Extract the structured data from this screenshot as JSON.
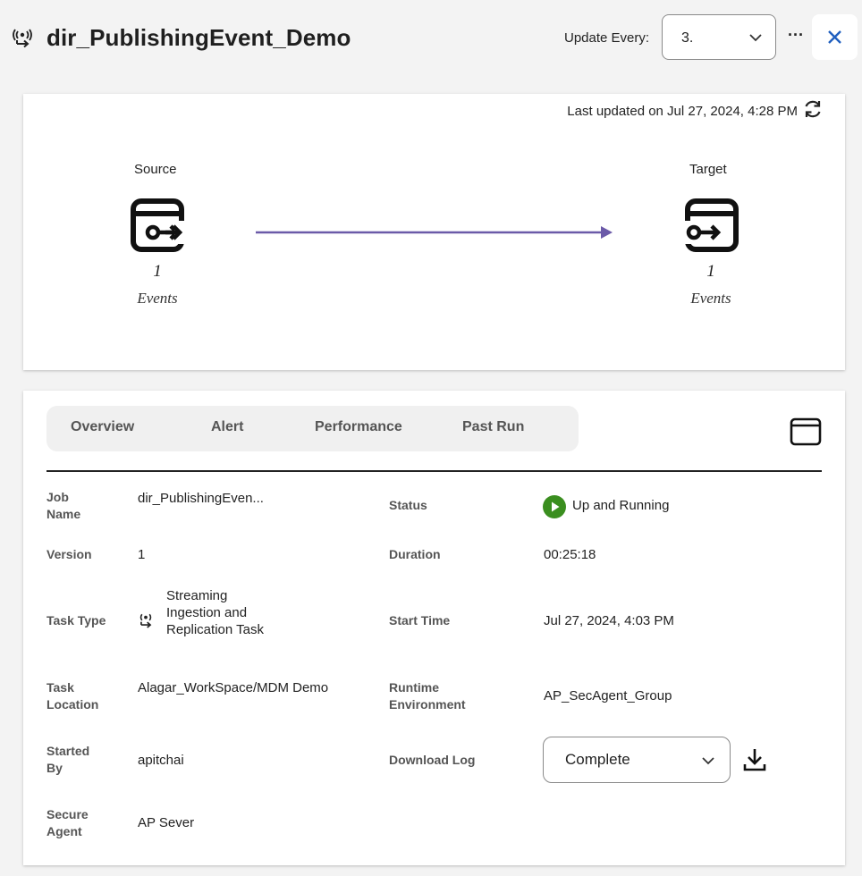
{
  "header": {
    "title": "dir_PublishingEvent_Demo",
    "update_label": "Update Every:",
    "update_value": "3.",
    "more_label": "···"
  },
  "flow": {
    "last_updated": "Last updated on Jul 27, 2024, 4:28 PM",
    "source": {
      "label": "Source",
      "count": "1",
      "unit": "Events"
    },
    "target": {
      "label": "Target",
      "count": "1",
      "unit": "Events"
    },
    "arrow_color": "#6b5aa8"
  },
  "tabs": [
    "Overview",
    "Alert",
    "Performance",
    "Past Run"
  ],
  "details": {
    "job_name": {
      "label": "Job Name",
      "value": "dir_PublishingEven..."
    },
    "version": {
      "label": "Version",
      "value": "1"
    },
    "task_type": {
      "label": "Task Type",
      "value": "Streaming Ingestion and Replication Task"
    },
    "task_location": {
      "label": "Task Location",
      "value": "Alagar_WorkSpace/MDM Demo"
    },
    "started_by": {
      "label": "Started By",
      "value": "apitchai"
    },
    "secure_agent": {
      "label": "Secure Agent",
      "value": "AP Sever"
    },
    "status": {
      "label": "Status",
      "value": "Up and Running",
      "color": "#3a8e1f"
    },
    "duration": {
      "label": "Duration",
      "value": "00:25:18"
    },
    "start_time": {
      "label": "Start Time",
      "value": "Jul 27, 2024, 4:03 PM"
    },
    "runtime_env": {
      "label": "Runtime Environment",
      "value": "AP_SecAgent_Group"
    },
    "download_log": {
      "label": "Download Log",
      "value": "Complete"
    }
  },
  "colors": {
    "accent": "#1f5fbf",
    "background": "#f3f3f3"
  },
  "icons": {
    "title": "streaming-task-icon",
    "close": "close-icon",
    "refresh": "refresh-icon",
    "source": "source-connector-icon",
    "target": "target-connector-icon",
    "panel": "panel-toggle-icon",
    "status": "play-icon",
    "download": "download-icon"
  }
}
